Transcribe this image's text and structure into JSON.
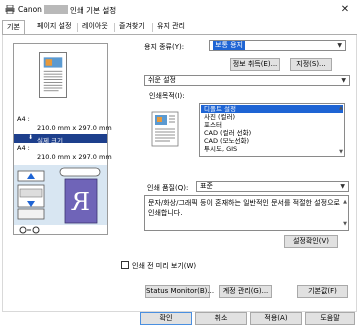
{
  "window": {
    "title_prefix": "Canon",
    "title_suffix": "인쇄 기본 설정",
    "close_glyph": "✕"
  },
  "tabs": [
    {
      "label": "기본",
      "active": true
    },
    {
      "label": "페이지 설정",
      "active": false
    },
    {
      "label": "레이아웃",
      "active": false
    },
    {
      "label": "즐겨찾기",
      "active": false
    },
    {
      "label": "유지 관리",
      "active": false
    }
  ],
  "preview": {
    "paper_lines": [
      "A4 :",
      "210.0 mm x 297.0 mm",
      "실제 크기",
      "A4 :",
      "210.0 mm x 297.0 mm"
    ],
    "selected_line": "실제 크기"
  },
  "paper_type": {
    "label": "용지 종류(Y):",
    "value": "보통 용지",
    "get_info_button": "정보 취득(E)...",
    "specify_button": "지정(S)..."
  },
  "easy_setup": {
    "value": "쉬운 설정"
  },
  "print_purpose": {
    "label": "인쇄목적(I):",
    "items": [
      "디폴트 설정",
      "사진 (컬러)",
      "포스터",
      "CAD (컬러 선화)",
      "CAD (모노선화)",
      "투시도, GIS"
    ],
    "selected_index": 0
  },
  "print_quality": {
    "label": "인쇄 품질(Q):",
    "value": "표준"
  },
  "description": "문자/화상/그래픽 등이 혼재하는 일반적인 문서를 적절한 설정으로 인쇄합니다.",
  "buttons": {
    "settings_confirm": "설정확인(V)",
    "print_preview_check": "인쇄 전 미리 보기(W)",
    "status_monitor": "Status Monitor(B)...",
    "account_manage": "계정 관리(G)...",
    "defaults": "기본값(F)",
    "ok": "확인",
    "cancel": "취소",
    "apply": "적용(A)",
    "help": "도움말"
  },
  "colors": {
    "selection_blue": "#1e64d4",
    "panel_selection_navy": "#1d3f8c",
    "button_face": "#e1e1e1"
  }
}
